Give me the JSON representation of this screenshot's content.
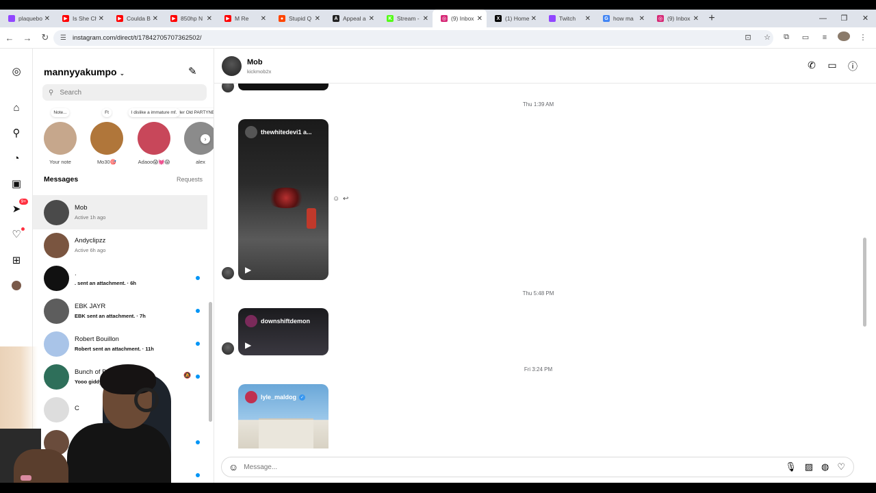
{
  "browser": {
    "tabs": [
      {
        "title": "plaquebo",
        "fav_color": "#9146ff",
        "fav_glyph": ""
      },
      {
        "title": "Is She Ch",
        "fav_color": "#ff0000",
        "fav_glyph": "▶"
      },
      {
        "title": "Coulda B",
        "fav_color": "#ff0000",
        "fav_glyph": "▶"
      },
      {
        "title": "850hp N",
        "fav_color": "#ff0000",
        "fav_glyph": "▶"
      },
      {
        "title": "M Re",
        "fav_color": "#ff0000",
        "fav_glyph": "▶"
      },
      {
        "title": "Stupid Q",
        "fav_color": "#ff4500",
        "fav_glyph": "●"
      },
      {
        "title": "Appeal a",
        "fav_color": "#222222",
        "fav_glyph": "A"
      },
      {
        "title": "Stream -",
        "fav_color": "#53fc18",
        "fav_glyph": "K"
      },
      {
        "title": "(9) Inbox",
        "fav_color": "#d62976",
        "fav_glyph": "◎"
      },
      {
        "title": "(1) Home",
        "fav_color": "#000000",
        "fav_glyph": "X"
      },
      {
        "title": "Twitch",
        "fav_color": "#9146ff",
        "fav_glyph": ""
      },
      {
        "title": "how ma",
        "fav_color": "#4285f4",
        "fav_glyph": "G"
      },
      {
        "title": "(9) Inbox",
        "fav_color": "#d62976",
        "fav_glyph": "◎"
      }
    ],
    "active_tab_index": 8,
    "url": "instagram.com/direct/t/17842705707362502/"
  },
  "sidebar": {
    "username": "mannyyakumpo",
    "search_placeholder": "Search",
    "notes": [
      {
        "bubble": "Note...",
        "name": "Your note",
        "color": "#c6a78c"
      },
      {
        "bubble": "Ft",
        "name": "Mo30🎯",
        "color": "#b0763a"
      },
      {
        "bubble": "I dislike a immature mf.",
        "name": "Adaoo😱💓😱",
        "color": "#c8475a"
      },
      {
        "bubble": "Her Old PARTYNEXTD",
        "name": "alex",
        "color": "#8b8b8b"
      }
    ],
    "messages_heading": "Messages",
    "requests_label": "Requests",
    "threads": [
      {
        "name": "Mob",
        "sub": "Active 1h ago",
        "sub_bold": false,
        "unread": false,
        "muted": false,
        "color": "#4a4a4a"
      },
      {
        "name": "Andyclipzz",
        "sub": "Active 6h ago",
        "sub_bold": false,
        "unread": false,
        "muted": false,
        "color": "#7a5540"
      },
      {
        "name": ".",
        "sub": ". sent an attachment. · 6h",
        "sub_bold": true,
        "unread": true,
        "muted": false,
        "color": "#111111"
      },
      {
        "name": "EBK JAYR",
        "sub": "EBK sent an attachment. · 7h",
        "sub_bold": true,
        "unread": true,
        "muted": false,
        "color": "#5d5d5d"
      },
      {
        "name": "Robert Bouillon",
        "sub": "Robert sent an attachment. · 11h",
        "sub_bold": true,
        "unread": true,
        "muted": false,
        "color": "#a9c4e8"
      },
      {
        "name": "Bunch of Bai",
        "sub": "Yooo giddy",
        "sub_bold": true,
        "unread": true,
        "muted": true,
        "color": "#2e6f5a"
      },
      {
        "name": "C",
        "sub": "",
        "sub_bold": false,
        "unread": false,
        "muted": false,
        "color": "#dddddd"
      },
      {
        "name": "",
        "sub": "",
        "sub_bold": false,
        "unread": true,
        "muted": false,
        "color": "#6a4c3c"
      },
      {
        "name": "",
        "sub": "",
        "sub_bold": false,
        "unread": true,
        "muted": false,
        "color": "#3a3a3a"
      }
    ]
  },
  "chat": {
    "name": "Mob",
    "handle": "kickmob2x",
    "timestamps": [
      "Thu 1:39 AM",
      "Thu 5:48 PM",
      "Fri 3:24 PM"
    ],
    "shared_posts": [
      {
        "account": "thewhitedevi1 a...",
        "verified": false
      },
      {
        "account": "downshiftdemon",
        "verified": false
      },
      {
        "account": "lyle_maldog",
        "verified": true
      }
    ],
    "composer_placeholder": "Message..."
  },
  "icons": {
    "call": "phone-icon",
    "video": "video-icon",
    "info": "info-icon",
    "mic": "microphone-icon",
    "image": "image-icon",
    "sticker": "sticker-icon",
    "like": "heart-icon"
  }
}
